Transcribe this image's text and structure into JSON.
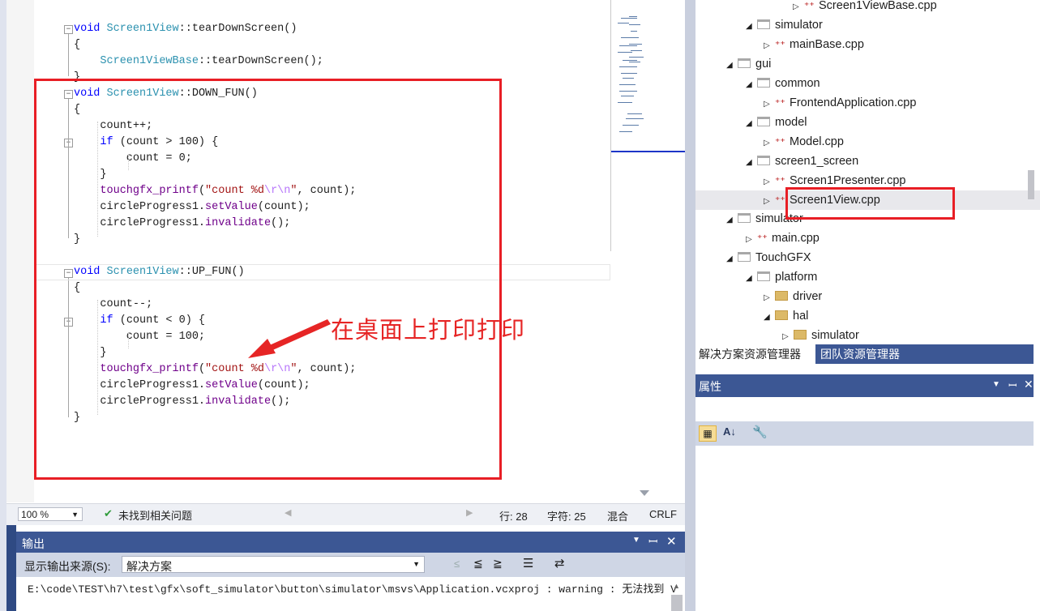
{
  "code_lines": [
    {
      "id": "l1",
      "parts": [
        {
          "c": "kw",
          "t": "void "
        },
        {
          "c": "ty",
          "t": "Screen1View"
        },
        {
          "c": "pl",
          "t": "::"
        },
        {
          "c": "pl",
          "t": "tearDownScreen"
        },
        {
          "c": "pl",
          "t": "()"
        }
      ]
    },
    {
      "id": "l2",
      "parts": [
        {
          "c": "pl",
          "t": "{"
        }
      ]
    },
    {
      "id": "l3",
      "parts": [
        {
          "c": "ty",
          "t": "    Screen1ViewBase"
        },
        {
          "c": "pl",
          "t": "::tearDownScreen();"
        }
      ]
    },
    {
      "id": "l4",
      "parts": [
        {
          "c": "pl",
          "t": "}"
        }
      ]
    },
    {
      "id": "l5",
      "parts": [
        {
          "c": "kw",
          "t": "void "
        },
        {
          "c": "ty",
          "t": "Screen1View"
        },
        {
          "c": "pl",
          "t": "::DOWN_FUN()"
        }
      ]
    },
    {
      "id": "l6",
      "parts": [
        {
          "c": "pl",
          "t": "{"
        }
      ]
    },
    {
      "id": "l7",
      "parts": [
        {
          "c": "pl",
          "t": "    count++;"
        }
      ]
    },
    {
      "id": "l8",
      "parts": [
        {
          "c": "kw",
          "t": "    if "
        },
        {
          "c": "pl",
          "t": "(count > 100) {"
        }
      ]
    },
    {
      "id": "l9",
      "parts": [
        {
          "c": "pl",
          "t": "        count = 0;"
        }
      ]
    },
    {
      "id": "l10",
      "parts": [
        {
          "c": "pl",
          "t": "    }"
        }
      ]
    },
    {
      "id": "l11",
      "parts": [
        {
          "c": "mt",
          "t": "    touchgfx_printf"
        },
        {
          "c": "pl",
          "t": "("
        },
        {
          "c": "st",
          "t": "\"count %d"
        },
        {
          "c": "esc",
          "t": "\\r\\n"
        },
        {
          "c": "st",
          "t": "\""
        },
        {
          "c": "pl",
          "t": ", count);"
        }
      ]
    },
    {
      "id": "l12",
      "parts": [
        {
          "c": "pl",
          "t": "    circleProgress1."
        },
        {
          "c": "mt",
          "t": "setValue"
        },
        {
          "c": "pl",
          "t": "(count);"
        }
      ]
    },
    {
      "id": "l13",
      "parts": [
        {
          "c": "pl",
          "t": "    circleProgress1."
        },
        {
          "c": "mt",
          "t": "invalidate"
        },
        {
          "c": "pl",
          "t": "();"
        }
      ]
    },
    {
      "id": "l14",
      "parts": [
        {
          "c": "pl",
          "t": "}"
        }
      ]
    },
    {
      "id": "l15",
      "parts": [
        {
          "c": "pl",
          "t": ""
        }
      ]
    },
    {
      "id": "l16",
      "parts": [
        {
          "c": "kw",
          "t": "void "
        },
        {
          "c": "ty",
          "t": "Screen1View"
        },
        {
          "c": "pl",
          "t": "::UP_FUN()"
        }
      ]
    },
    {
      "id": "l17",
      "parts": [
        {
          "c": "pl",
          "t": "{"
        }
      ]
    },
    {
      "id": "l18",
      "parts": [
        {
          "c": "pl",
          "t": "    count--;"
        }
      ]
    },
    {
      "id": "l19",
      "parts": [
        {
          "c": "kw",
          "t": "    if "
        },
        {
          "c": "pl",
          "t": "(count < 0) {"
        }
      ]
    },
    {
      "id": "l20",
      "parts": [
        {
          "c": "pl",
          "t": "        count = 100;"
        }
      ]
    },
    {
      "id": "l21",
      "parts": [
        {
          "c": "pl",
          "t": "    }"
        }
      ]
    },
    {
      "id": "l22",
      "parts": [
        {
          "c": "mt",
          "t": "    touchgfx_printf"
        },
        {
          "c": "pl",
          "t": "("
        },
        {
          "c": "st",
          "t": "\"count %d"
        },
        {
          "c": "esc",
          "t": "\\r\\n"
        },
        {
          "c": "st",
          "t": "\""
        },
        {
          "c": "pl",
          "t": ", count);"
        }
      ]
    },
    {
      "id": "l23",
      "parts": [
        {
          "c": "pl",
          "t": "    circleProgress1."
        },
        {
          "c": "mt",
          "t": "setValue"
        },
        {
          "c": "pl",
          "t": "(count);"
        }
      ]
    },
    {
      "id": "l24",
      "parts": [
        {
          "c": "pl",
          "t": "    circleProgress1."
        },
        {
          "c": "mt",
          "t": "invalidate"
        },
        {
          "c": "pl",
          "t": "();"
        }
      ]
    },
    {
      "id": "l25",
      "parts": [
        {
          "c": "pl",
          "t": "}"
        }
      ]
    }
  ],
  "annotation": "在桌面上打印打印",
  "status": {
    "zoom": "100 %",
    "issues": "未找到相关问题",
    "line": "行: 28",
    "char": "字符: 25",
    "mode": "混合",
    "eol": "CRLF"
  },
  "output": {
    "title": "输出",
    "source_label": "显示输出来源(S):",
    "source_value": "解决方案",
    "log_line": "E:\\code\\TEST\\h7\\test\\gfx\\soft_simulator\\button\\simulator\\msvs\\Application.vcxproj : warning  : 无法找到 V"
  },
  "solution_tree": [
    {
      "id": "t0",
      "kind": "cpp",
      "label": "Screen1ViewBase.cpp"
    },
    {
      "id": "t1",
      "kind": "filter",
      "label": "simulator"
    },
    {
      "id": "t2",
      "kind": "cpp",
      "label": "mainBase.cpp"
    },
    {
      "id": "t3",
      "kind": "filter",
      "label": "gui"
    },
    {
      "id": "t4",
      "kind": "filter",
      "label": "common"
    },
    {
      "id": "t5",
      "kind": "cpp",
      "label": "FrontendApplication.cpp"
    },
    {
      "id": "t6",
      "kind": "filter",
      "label": "model"
    },
    {
      "id": "t7",
      "kind": "cpp",
      "label": "Model.cpp"
    },
    {
      "id": "t8",
      "kind": "filter",
      "label": "screen1_screen"
    },
    {
      "id": "t9",
      "kind": "cpp",
      "label": "Screen1Presenter.cpp"
    },
    {
      "id": "t10",
      "kind": "cpp",
      "label": "Screen1View.cpp"
    },
    {
      "id": "t11",
      "kind": "filter",
      "label": "simulator"
    },
    {
      "id": "t12",
      "kind": "cpp",
      "label": "main.cpp"
    },
    {
      "id": "t13",
      "kind": "filter",
      "label": "TouchGFX"
    },
    {
      "id": "t14",
      "kind": "filter",
      "label": "platform"
    },
    {
      "id": "t15",
      "kind": "folder",
      "label": "driver"
    },
    {
      "id": "t16",
      "kind": "folder",
      "label": "hal"
    },
    {
      "id": "t17",
      "kind": "folder",
      "label": "simulator"
    }
  ],
  "tabs": {
    "solution_explorer": "解决方案资源管理器",
    "team_explorer": "团队资源管理器"
  },
  "properties": {
    "title": "属性"
  },
  "colors": {
    "highlight_box": "#e81e25",
    "annotation_text": "#e62525",
    "panel_header": "#3c5794"
  },
  "icons": [
    "fold-collapse-icon",
    "check-icon",
    "triangle-expanded-icon",
    "triangle-collapsed-icon",
    "filter-folder-icon",
    "folder-icon",
    "cpp-file-icon",
    "dropdown-icon",
    "pin-icon",
    "close-icon",
    "categorized-icon",
    "alphabetical-icon",
    "wrench-icon",
    "wrap-icon"
  ]
}
